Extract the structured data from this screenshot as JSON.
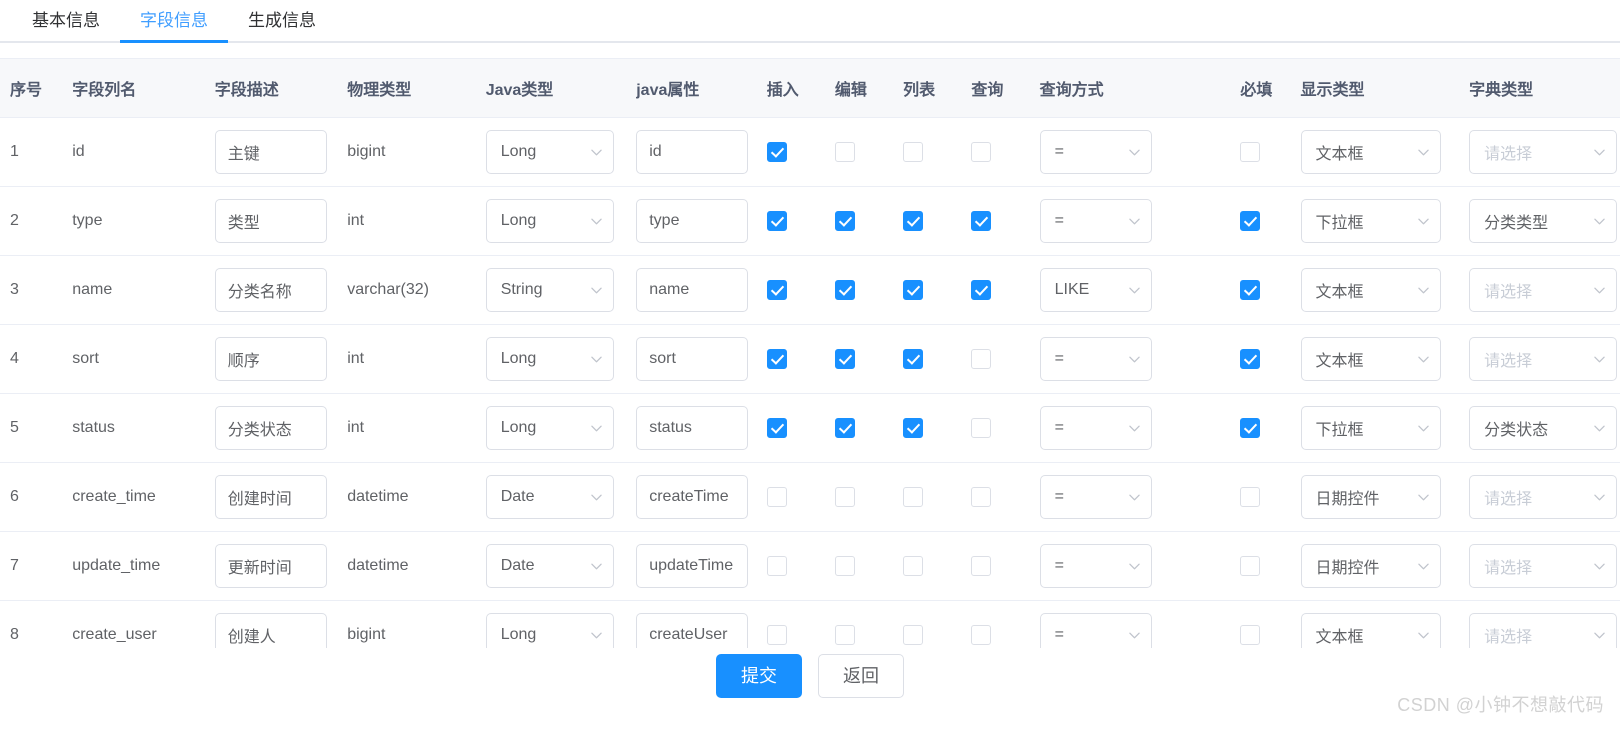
{
  "tabs": [
    {
      "label": "基本信息",
      "active": false
    },
    {
      "label": "字段信息",
      "active": true
    },
    {
      "label": "生成信息",
      "active": false
    }
  ],
  "table": {
    "headers": {
      "index": "序号",
      "column_name": "字段列名",
      "column_comment": "字段描述",
      "physical_type": "物理类型",
      "java_type": "Java类型",
      "java_field": "java属性",
      "insert": "插入",
      "edit": "编辑",
      "list": "列表",
      "query": "查询",
      "query_type": "查询方式",
      "required": "必填",
      "display_type": "显示类型",
      "dict_type": "字典类型"
    },
    "placeholder_select": "请选择",
    "rows": [
      {
        "index": "1",
        "column_name": "id",
        "column_comment": "主键",
        "physical_type": "bigint",
        "java_type": "Long",
        "java_field": "id",
        "insert": true,
        "edit": false,
        "list": false,
        "query": false,
        "query_type": "=",
        "required": false,
        "display_type": "文本框",
        "dict_type": "请选择",
        "dict_is_placeholder": true
      },
      {
        "index": "2",
        "column_name": "type",
        "column_comment": "类型",
        "physical_type": "int",
        "java_type": "Long",
        "java_field": "type",
        "insert": true,
        "edit": true,
        "list": true,
        "query": true,
        "query_type": "=",
        "required": true,
        "display_type": "下拉框",
        "dict_type": "分类类型",
        "dict_is_placeholder": false
      },
      {
        "index": "3",
        "column_name": "name",
        "column_comment": "分类名称",
        "physical_type": "varchar(32)",
        "java_type": "String",
        "java_field": "name",
        "insert": true,
        "edit": true,
        "list": true,
        "query": true,
        "query_type": "LIKE",
        "required": true,
        "display_type": "文本框",
        "dict_type": "请选择",
        "dict_is_placeholder": true
      },
      {
        "index": "4",
        "column_name": "sort",
        "column_comment": "顺序",
        "physical_type": "int",
        "java_type": "Long",
        "java_field": "sort",
        "insert": true,
        "edit": true,
        "list": true,
        "query": false,
        "query_type": "=",
        "required": true,
        "display_type": "文本框",
        "dict_type": "请选择",
        "dict_is_placeholder": true
      },
      {
        "index": "5",
        "column_name": "status",
        "column_comment": "分类状态",
        "physical_type": "int",
        "java_type": "Long",
        "java_field": "status",
        "insert": true,
        "edit": true,
        "list": true,
        "query": false,
        "query_type": "=",
        "required": true,
        "display_type": "下拉框",
        "dict_type": "分类状态",
        "dict_is_placeholder": false
      },
      {
        "index": "6",
        "column_name": "create_time",
        "column_comment": "创建时间",
        "physical_type": "datetime",
        "java_type": "Date",
        "java_field": "createTime",
        "insert": false,
        "edit": false,
        "list": false,
        "query": false,
        "query_type": "=",
        "required": false,
        "display_type": "日期控件",
        "dict_type": "请选择",
        "dict_is_placeholder": true
      },
      {
        "index": "7",
        "column_name": "update_time",
        "column_comment": "更新时间",
        "physical_type": "datetime",
        "java_type": "Date",
        "java_field": "updateTime",
        "insert": false,
        "edit": false,
        "list": false,
        "query": false,
        "query_type": "=",
        "required": false,
        "display_type": "日期控件",
        "dict_type": "请选择",
        "dict_is_placeholder": true
      },
      {
        "index": "8",
        "column_name": "create_user",
        "column_comment": "创建人",
        "physical_type": "bigint",
        "java_type": "Long",
        "java_field": "createUser",
        "insert": false,
        "edit": false,
        "list": false,
        "query": false,
        "query_type": "=",
        "required": false,
        "display_type": "文本框",
        "dict_type": "请选择",
        "dict_is_placeholder": true
      }
    ]
  },
  "footer": {
    "submit_label": "提交",
    "back_label": "返回"
  },
  "watermark": "CSDN @小钟不想敲代码",
  "colors": {
    "accent": "#1890ff",
    "tab_active": "#409eff",
    "border": "#dcdfe6",
    "row_border": "#ebeef5",
    "header_bg": "#f7f8fa",
    "text": "#606266",
    "placeholder": "#c8cdd6"
  }
}
